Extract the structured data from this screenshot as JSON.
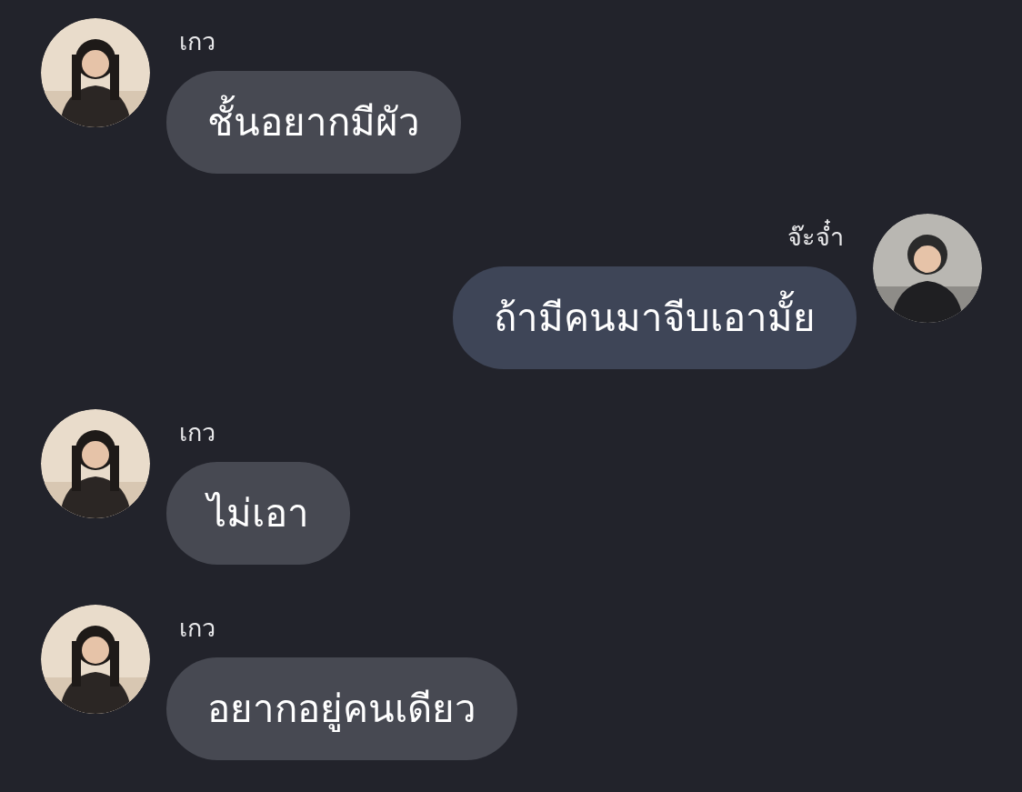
{
  "messages": [
    {
      "kind": "incoming",
      "sender": "เกว",
      "text": "ชั้นอยากมีผัว"
    },
    {
      "kind": "outgoing",
      "sender": "จ๊ะจ๋ำ",
      "text": "ถ้ามีคนมาจีบเอามั้ย"
    },
    {
      "kind": "incoming",
      "sender": "เกว",
      "text": "ไม่เอา"
    },
    {
      "kind": "incoming",
      "sender": "เกว",
      "text": "อยากอยู่คนเดียว"
    }
  ]
}
